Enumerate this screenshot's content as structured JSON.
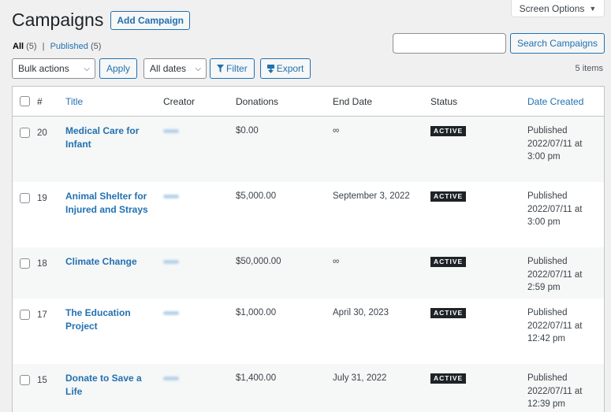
{
  "screen_options": {
    "label": "Screen Options",
    "icon": "caret-down-icon"
  },
  "header": {
    "title": "Campaigns",
    "add_label": "Add Campaign"
  },
  "views": {
    "all_label": "All",
    "all_count": "(5)",
    "separator": "|",
    "published_label": "Published",
    "published_count": "(5)"
  },
  "search": {
    "value": "",
    "button_label": "Search Campaigns"
  },
  "toolbar": {
    "bulk_actions": "Bulk actions",
    "apply_label": "Apply",
    "dates": "All dates",
    "filter_label": "Filter",
    "export_label": "Export",
    "items_count": "5 items"
  },
  "columns": {
    "num": "#",
    "title": "Title",
    "creator": "Creator",
    "donations": "Donations",
    "end_date": "End Date",
    "status": "Status",
    "date_created": "Date Created"
  },
  "rows": [
    {
      "id": "20",
      "title_lines": [
        "Medical Care for",
        "Infant"
      ],
      "donations": "$0.00",
      "end_date": "∞",
      "status": "ACTIVE",
      "date_lines": [
        "Published",
        "2022/07/11 at",
        "3:00 pm"
      ]
    },
    {
      "id": "19",
      "title_lines": [
        "Animal Shelter for",
        "Injured and Strays"
      ],
      "donations": "$5,000.00",
      "end_date": "September 3, 2022",
      "status": "ACTIVE",
      "date_lines": [
        "Published",
        "2022/07/11 at",
        "3:00 pm"
      ]
    },
    {
      "id": "18",
      "title_lines": [
        "Climate Change"
      ],
      "donations": "$50,000.00",
      "end_date": "∞",
      "status": "ACTIVE",
      "date_lines": [
        "Published",
        "2022/07/11 at",
        "2:59 pm"
      ]
    },
    {
      "id": "17",
      "title_lines": [
        "The Education",
        "Project"
      ],
      "donations": "$1,000.00",
      "end_date": "April 30, 2023",
      "status": "ACTIVE",
      "date_lines": [
        "Published",
        "2022/07/11 at",
        "12:42 pm"
      ]
    },
    {
      "id": "15",
      "title_lines": [
        "Donate to Save a",
        "Life"
      ],
      "donations": "$1,400.00",
      "end_date": "July 31, 2022",
      "status": "ACTIVE",
      "date_lines": [
        "Published",
        "2022/07/11 at",
        "12:39 pm"
      ]
    }
  ]
}
